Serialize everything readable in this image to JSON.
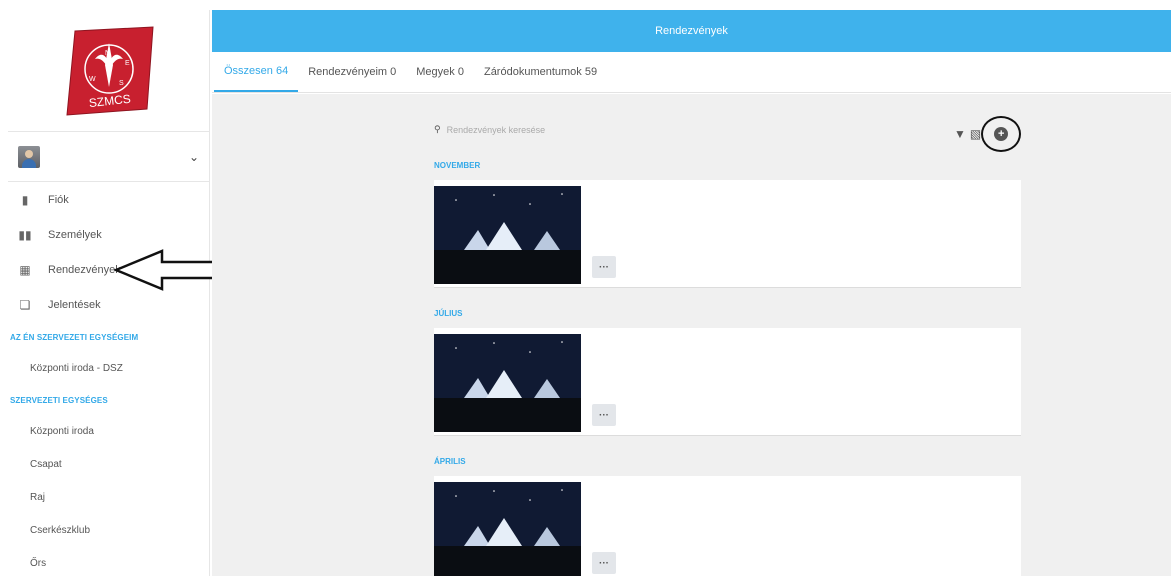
{
  "header": {
    "title": "Rendezvények"
  },
  "tabs": [
    {
      "label": "Összesen 64",
      "active": true
    },
    {
      "label": "Rendezvényeim 0"
    },
    {
      "label": "Megyek 0"
    },
    {
      "label": "Záródokumentumok 59"
    }
  ],
  "search": {
    "placeholder": "Rendezvények keresése"
  },
  "sidebar": {
    "logo_text": "SZMCS",
    "compass": {
      "n": "N",
      "e": "E",
      "s": "S",
      "w": "W"
    },
    "nav": [
      {
        "label": "Fiók",
        "icon": "person-icon"
      },
      {
        "label": "Személyek",
        "icon": "people-icon"
      },
      {
        "label": "Rendezvények",
        "icon": "calendar-icon"
      },
      {
        "label": "Jelentések",
        "icon": "documents-icon"
      }
    ],
    "section1_title": "AZ ÉN SZERVEZETI EGYSÉGEIM",
    "section1_items": [
      "Központi iroda - DSZ"
    ],
    "section2_title": "SZERVEZETI EGYSÉGES",
    "section2_items": [
      "Központi iroda",
      "Csapat",
      "Raj",
      "Cserkészklub",
      "Őrs"
    ]
  },
  "events": [
    {
      "month": "NOVEMBER"
    },
    {
      "month": "JÚLIUS"
    },
    {
      "month": "ÁPRILIS"
    }
  ],
  "more_label": "···",
  "colors": {
    "accent": "#3fb2ec",
    "logo_red": "#c8202f"
  }
}
